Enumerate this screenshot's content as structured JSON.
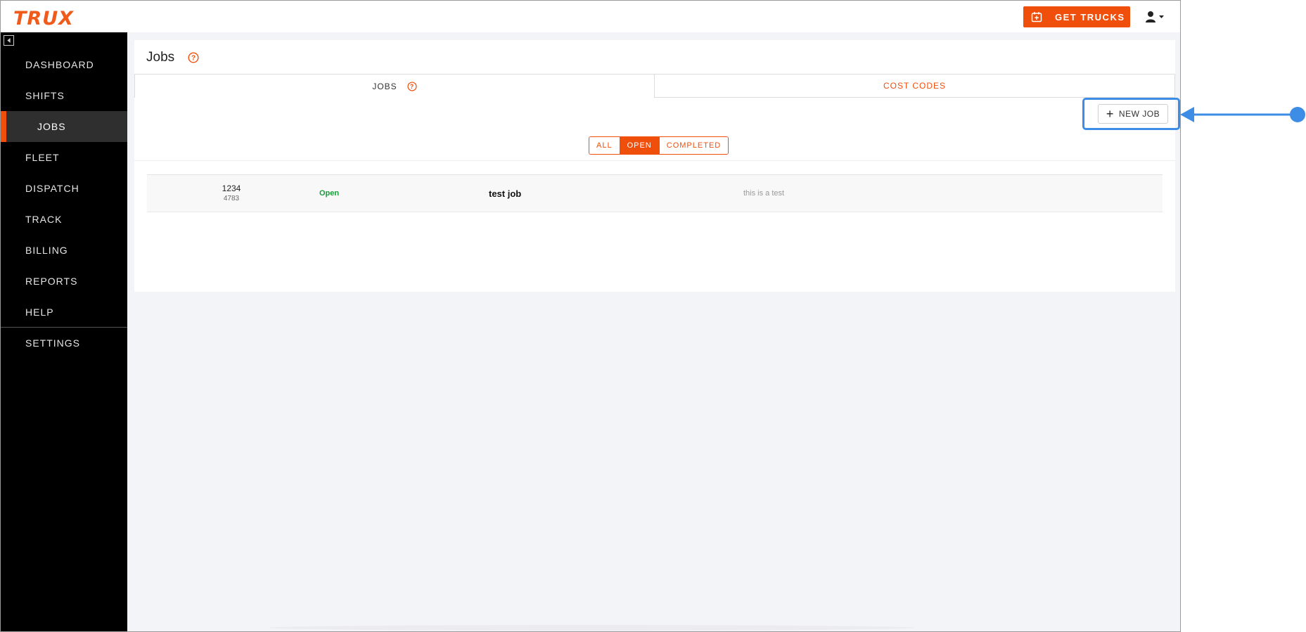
{
  "app": {
    "logo_text": "TRUX",
    "brand_color": "#f04e0b",
    "accent_highlight_color": "#3d8de6"
  },
  "topbar": {
    "get_trucks_label": "GET TRUCKS",
    "get_trucks_icon": "calendar-plus-icon",
    "user_menu_icon": "user-icon"
  },
  "sidebar": {
    "collapse_icon": "collapse-left-icon",
    "items": [
      {
        "label": "DASHBOARD",
        "active": false
      },
      {
        "label": "SHIFTS",
        "active": false
      },
      {
        "label": "JOBS",
        "active": true
      },
      {
        "label": "FLEET",
        "active": false
      },
      {
        "label": "DISPATCH",
        "active": false
      },
      {
        "label": "TRACK",
        "active": false
      },
      {
        "label": "BILLING",
        "active": false
      },
      {
        "label": "REPORTS",
        "active": false
      },
      {
        "label": "HELP",
        "active": false
      }
    ],
    "settings_label": "SETTINGS"
  },
  "main": {
    "title": "Jobs",
    "tabs": [
      {
        "label": "JOBS",
        "active": true
      },
      {
        "label": "COST CODES",
        "active": false
      }
    ],
    "new_job_label": "NEW JOB",
    "filters": [
      {
        "label": "ALL",
        "selected": false
      },
      {
        "label": "OPEN",
        "selected": true
      },
      {
        "label": "COMPLETED",
        "selected": false
      }
    ],
    "jobs": [
      {
        "number": "1234",
        "sub_number": "4783",
        "status": "Open",
        "name": "test job",
        "description": "this is a test"
      }
    ]
  }
}
